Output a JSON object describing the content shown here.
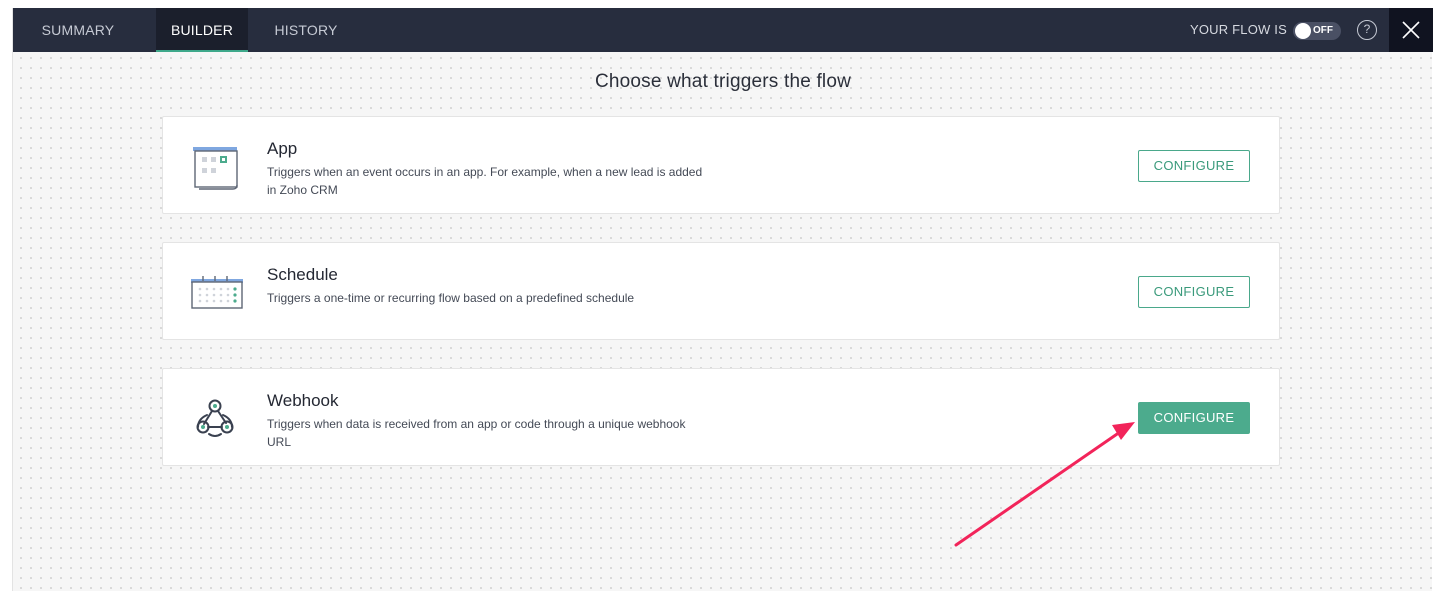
{
  "nav": {
    "tabs": [
      {
        "label": "SUMMARY"
      },
      {
        "label": "BUILDER"
      },
      {
        "label": "HISTORY"
      }
    ],
    "flow_status_label": "YOUR FLOW IS",
    "toggle_state": "OFF",
    "help_glyph": "?",
    "close_icon": "close-icon"
  },
  "main": {
    "heading": "Choose what triggers the flow",
    "triggers": [
      {
        "title": "App",
        "description": "Triggers when an event occurs in an app. For example, when a new lead is added in Zoho CRM",
        "button_label": "CONFIGURE",
        "icon": "app-calendar-icon"
      },
      {
        "title": "Schedule",
        "description": "Triggers a one-time or recurring flow based on a predefined schedule",
        "button_label": "CONFIGURE",
        "icon": "schedule-calendar-icon"
      },
      {
        "title": "Webhook",
        "description": "Triggers when data is received from an app or code through a unique webhook URL",
        "button_label": "CONFIGURE",
        "icon": "webhook-icon"
      }
    ]
  },
  "colors": {
    "topbar": "#272d3e",
    "active_tab": "#1b1f2c",
    "accent": "#4cab8d",
    "annotation_arrow": "#f2245a"
  }
}
